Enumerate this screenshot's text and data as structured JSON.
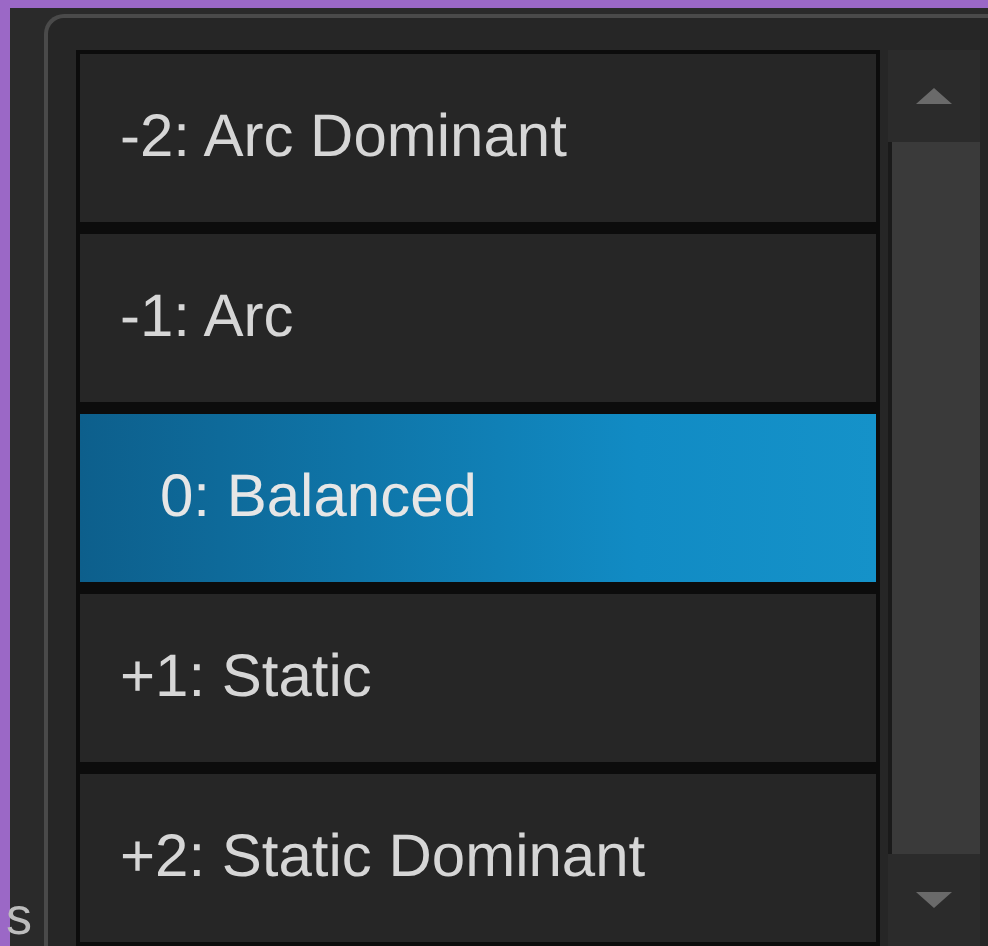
{
  "background_label": "s",
  "options": [
    {
      "label": "-2: Arc Dominant",
      "selected": false
    },
    {
      "label": "-1: Arc",
      "selected": false
    },
    {
      "label": "0: Balanced",
      "selected": true
    },
    {
      "label": "+1: Static",
      "selected": false
    },
    {
      "label": "+2: Static Dominant",
      "selected": false
    }
  ]
}
